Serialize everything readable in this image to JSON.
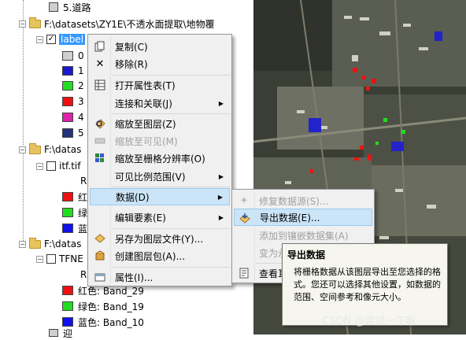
{
  "toc": {
    "top_item": "5.道路",
    "group1": "F:\\datasets\\ZY1E\\不透水面提取\\地物覆",
    "layer_label": "label",
    "legend": [
      {
        "value": "0",
        "color": "#cfcfcf"
      },
      {
        "value": "1",
        "color": "#1a1acc"
      },
      {
        "value": "2",
        "color": "#22dd22"
      },
      {
        "value": "3",
        "color": "#ee1111"
      },
      {
        "value": "4",
        "color": "#dd22aa"
      },
      {
        "value": "5",
        "color": "#22337a"
      }
    ],
    "group2": "F:\\datas",
    "layer2": "itf.tif",
    "layer2_r": "R",
    "layer2_bands": [
      {
        "label": "红",
        "color": "#ee1111"
      },
      {
        "label": "绿",
        "color": "#22dd22"
      },
      {
        "label": "蓝",
        "color": "#1111ee"
      }
    ],
    "group3": "F:\\datas",
    "layer3": "TFNE",
    "layer3_r": "R",
    "layer3_bands": [
      {
        "label": "红色:  Band_29",
        "color": "#ee1111"
      },
      {
        "label": "绿色:  Band_19",
        "color": "#22dd22"
      },
      {
        "label": "蓝色:  Band_10",
        "color": "#1111ee"
      }
    ],
    "bottom_partial": "迎"
  },
  "context_menu": {
    "items": [
      {
        "label": "复制(C)",
        "icon": "copy-icon"
      },
      {
        "label": "移除(R)",
        "icon": "remove-icon"
      },
      {
        "label": "打开属性表(T)",
        "icon": "table-icon"
      },
      {
        "label": "连接和关联(J)",
        "icon": "none"
      },
      {
        "label": "缩放至图层(Z)",
        "icon": "zoom-layer-icon"
      },
      {
        "label": "缩放至可见(M)",
        "icon": "zoom-visible-icon"
      },
      {
        "label": "缩放至栅格分辨率(O)",
        "icon": "zoom-raster-icon"
      },
      {
        "label": "可见比例范围(V)",
        "icon": "none"
      },
      {
        "label": "数据(D)",
        "icon": "none"
      },
      {
        "label": "编辑要素(E)",
        "icon": "none"
      },
      {
        "label": "另存为图层文件(Y)...",
        "icon": "layer-file-icon"
      },
      {
        "label": "创建图层包(A)...",
        "icon": "layer-package-icon"
      },
      {
        "label": "属性(I)...",
        "icon": "properties-icon"
      }
    ]
  },
  "submenu": {
    "items": [
      {
        "label": "修复数据源(S)..."
      },
      {
        "label": "导出数据(E)..."
      },
      {
        "label": "添加到镶嵌数据集(A)"
      },
      {
        "label": "变为永"
      },
      {
        "label": "查看耳"
      }
    ]
  },
  "tooltip": {
    "title": "导出数据",
    "body": "将栅格数据从该图层导出至您选择的格式。您还可以选择其他设置，如数据的范围、空间参考和像元大小。"
  },
  "watermark": "CSDN @尝试一下嘛"
}
